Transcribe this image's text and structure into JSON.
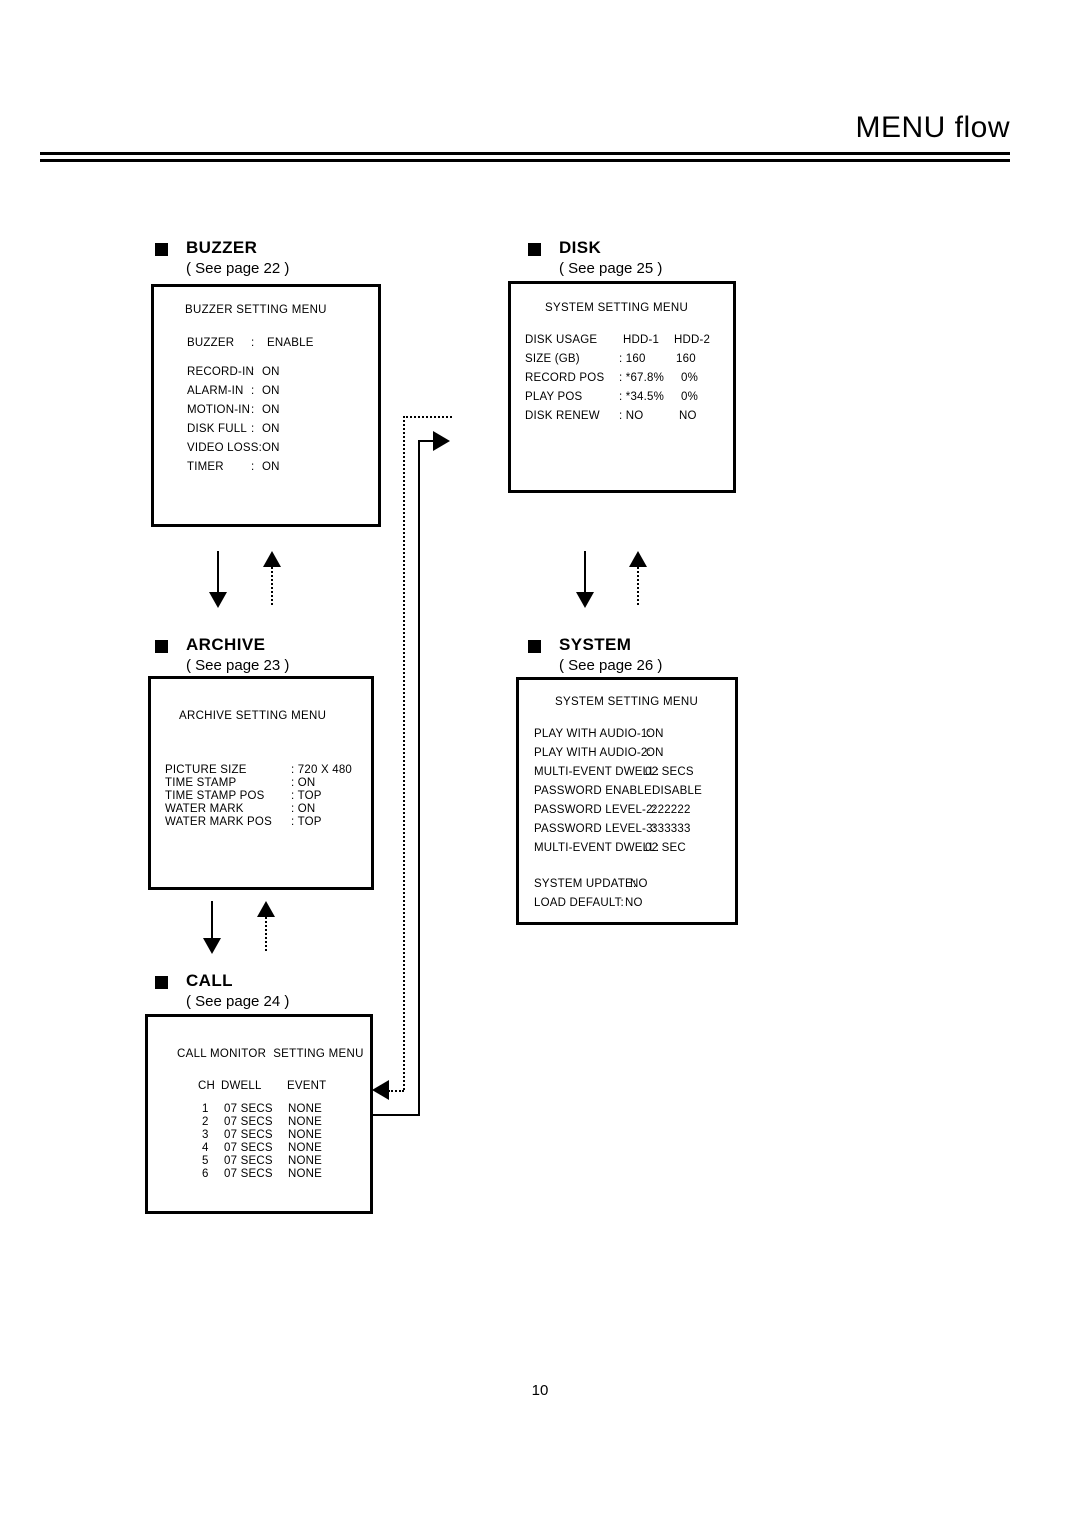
{
  "header": {
    "title": "MENU flow"
  },
  "footer": {
    "page_number": "10"
  },
  "sections": {
    "buzzer": {
      "title": "BUZZER",
      "see_page": "( See page 22 )",
      "menu_title": "BUZZER SETTING MENU",
      "rows": [
        {
          "label": "BUZZER",
          "sep": ":",
          "value": "ENABLE"
        },
        {
          "label": "RECORD-IN",
          "sep": ":",
          "value": "ON"
        },
        {
          "label": "ALARM-IN",
          "sep": ":",
          "value": "ON"
        },
        {
          "label": "MOTION-IN",
          "sep": ":",
          "value": "ON"
        },
        {
          "label": "DISK FULL",
          "sep": ":",
          "value": "ON"
        },
        {
          "label": "VIDEO LOSS:",
          "sep": "",
          "value": "ON"
        },
        {
          "label": "TIMER",
          "sep": ":",
          "value": "ON"
        }
      ]
    },
    "archive": {
      "title": "ARCHIVE",
      "see_page": "( See page 23 )",
      "menu_title": "ARCHIVE SETTING MENU",
      "rows": [
        {
          "label": "PICTURE SIZE",
          "value": ": 720 X 480"
        },
        {
          "label": "TIME STAMP",
          "value": ": ON"
        },
        {
          "label": "TIME STAMP POS",
          "value": ": TOP"
        },
        {
          "label": "WATER MARK",
          "value": ": ON"
        },
        {
          "label": "WATER MARK POS",
          "value": ": TOP"
        }
      ]
    },
    "call": {
      "title": "CALL",
      "see_page": "( See page 24 )",
      "menu_title": "CALL MONITOR  SETTING MENU",
      "columns": [
        "CH",
        "DWELL",
        "EVENT"
      ],
      "rows": [
        {
          "ch": "1",
          "dwell": "07 SECS",
          "event": "NONE"
        },
        {
          "ch": "2",
          "dwell": "07 SECS",
          "event": "NONE"
        },
        {
          "ch": "3",
          "dwell": "07 SECS",
          "event": "NONE"
        },
        {
          "ch": "4",
          "dwell": "07 SECS",
          "event": "NONE"
        },
        {
          "ch": "5",
          "dwell": "07 SECS",
          "event": "NONE"
        },
        {
          "ch": "6",
          "dwell": "07 SECS",
          "event": "NONE"
        }
      ]
    },
    "disk": {
      "title": "DISK",
      "see_page": "( See page 25 )",
      "menu_title": "SYSTEM SETTING MENU",
      "rows": [
        {
          "label": "DISK USAGE",
          "hdd1": "HDD-1",
          "hdd2": "HDD-2"
        },
        {
          "label": "SIZE (GB)",
          "hdd1": ": 160",
          "hdd2": "160"
        },
        {
          "label": "RECORD POS",
          "hdd1": ": *67.8%",
          "hdd2": "0%"
        },
        {
          "label": "PLAY POS",
          "hdd1": ": *34.5%",
          "hdd2": "0%"
        },
        {
          "label": "DISK RENEW",
          "hdd1": ": NO",
          "hdd2": "NO"
        }
      ]
    },
    "system": {
      "title": "SYSTEM",
      "see_page": "( See page 26 )",
      "menu_title": "SYSTEM SETTING MENU",
      "rows": [
        {
          "label": "PLAY WITH AUDIO-1:",
          "value": "ON"
        },
        {
          "label": "PLAY WITH AUDIO-2:",
          "value": "ON"
        },
        {
          "label": "MULTI-EVENT DWELL:",
          "value": "02 SECS"
        },
        {
          "label": "PASSWORD ENABLE:",
          "value": "DISABLE"
        },
        {
          "label": "PASSWORD LEVEL-2:",
          "value": "222222"
        },
        {
          "label": "PASSWORD LEVEL-3:",
          "value": "333333"
        },
        {
          "label": "MULTI-EVENT DWELL:",
          "value": "02 SEC"
        },
        {
          "label": "SYSTEM UPDATE:",
          "value": "NO"
        },
        {
          "label": "LOAD DEFAULT:",
          "value": "NO"
        }
      ]
    }
  }
}
